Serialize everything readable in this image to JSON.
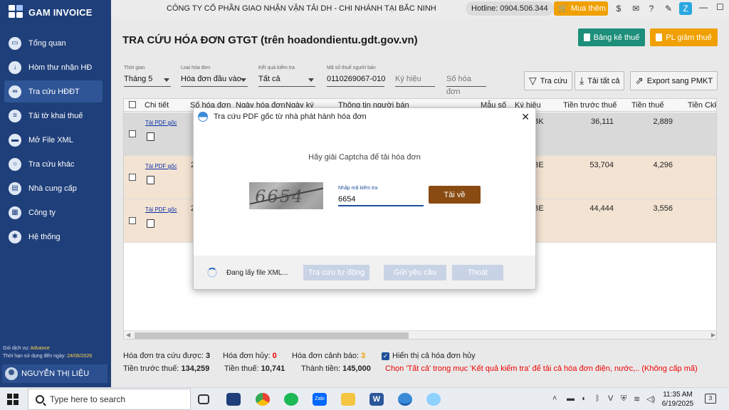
{
  "app": {
    "name": "GAM INVOICE"
  },
  "sidebar": {
    "items": [
      {
        "label": "Tổng quan",
        "icon": "monitor-icon"
      },
      {
        "label": "Hòm thư nhận HĐ",
        "icon": "download-icon"
      },
      {
        "label": "Tra cứu HĐĐT",
        "icon": "link-icon",
        "active": true
      },
      {
        "label": "Tải tờ khai thuế",
        "icon": "document-icon"
      },
      {
        "label": "Mở File XML",
        "icon": "folder-icon"
      },
      {
        "label": "Tra cứu khác",
        "icon": "search-icon"
      },
      {
        "label": "Nhà cung cấp",
        "icon": "supplier-icon"
      },
      {
        "label": "Công ty",
        "icon": "company-icon"
      },
      {
        "label": "Hệ thống",
        "icon": "settings-icon"
      }
    ],
    "service_label": "Gói dịch vụ:",
    "service_value": "Advance",
    "expiry_label": "Thời hạn sử dụng đến ngày:",
    "expiry_value": "24/06/2026",
    "user_name": "NGUYỄN THỊ LIỆU"
  },
  "topbar": {
    "company": "CÔNG TY CỔ PHẦN GIAO NHẬN VẬN TẢI DH - CHI NHÁNH TẠI BẮC NINH",
    "hotline": "Hotline: 0904.506.344",
    "buy_label": "Mua thêm"
  },
  "page": {
    "title": "TRA CỨU HÓA ĐƠN GTGT (trên hoadondientu.gdt.gov.vn)",
    "tax_list_button": "Bảng kê thuế",
    "pl_button": "PL giảm thuế"
  },
  "filters": {
    "period": {
      "label": "Thời gian",
      "value": "Tháng 5"
    },
    "invoice_type": {
      "label": "Loại hóa đơn",
      "value": "Hóa đơn đầu vào"
    },
    "check_result": {
      "label": "Kết quả kiểm tra",
      "value": "Tất cả"
    },
    "seller_tax": {
      "label": "Mã số thuế người bán",
      "value": "0110269067-010"
    },
    "symbol_placeholder": "Ký hiệu",
    "number_placeholder": "Số hóa đơn",
    "search_button": "Tra cứu",
    "download_all_button": "Tải tất cả",
    "export_button": "Export sang PMKT"
  },
  "grid": {
    "columns": [
      "Chi tiết",
      "Số hóa đơn",
      "Ngày hóa đơn",
      "Ngày ký",
      "Thông tin người bán",
      "Mẫu số",
      "Ký hiệu",
      "Tiền trước thuế",
      "Tiền thuế",
      "Tiền Ckk"
    ],
    "rows": [
      {
        "link": "Tải PDF gốc",
        "num_partial": "",
        "symbol_partial": "BK",
        "pre_tax": "36,111",
        "tax": "2,889"
      },
      {
        "link": "Tải PDF gốc",
        "num_partial": "2",
        "symbol_partial": "BE",
        "pre_tax": "53,704",
        "tax": "4,296"
      },
      {
        "link": "Tải PDF gốc",
        "num_partial": "2",
        "symbol_partial": "BE",
        "pre_tax": "44,444",
        "tax": "3,556"
      }
    ]
  },
  "footer": {
    "searched_label": "Hóa đơn tra cứu được:",
    "searched_value": "3",
    "cancelled_label": "Hóa đơn hủy:",
    "cancelled_value": "0",
    "warning_label": "Hóa đơn cảnh báo:",
    "warning_value": "3",
    "show_cancelled": "Hiển thị cả hóa đơn hủy",
    "pretax_label": "Tiền trước thuế:",
    "pretax_value": "134,259",
    "tax_label": "Tiền thuế:",
    "tax_value": "10,741",
    "total_label": "Thành tiền:",
    "total_value": "145,000",
    "note": "Chọn 'Tất cả' trong mục 'Kết quả kiểm tra' để tải cả hóa đơn điện, nước,.. (Không cấp mã)"
  },
  "modal": {
    "title": "Tra cứu PDF gốc từ nhà phát hành hóa đơn",
    "prompt": "Hãy giải Captcha để tải hóa đơn",
    "captcha_text": "6654",
    "input_label": "Nhập mã kiểm tra",
    "input_value": "6654",
    "download_button": "Tải về",
    "loading_text": "Đang lấy file XML...",
    "auto_search_button": "Tra cứu tự động",
    "send_request_button": "Gửi yêu cầu",
    "exit_button": "Thoát"
  },
  "taskbar": {
    "search_placeholder": "Type here to search",
    "time": "11:35 AM",
    "date": "6/19/2025",
    "notifications": "3"
  }
}
